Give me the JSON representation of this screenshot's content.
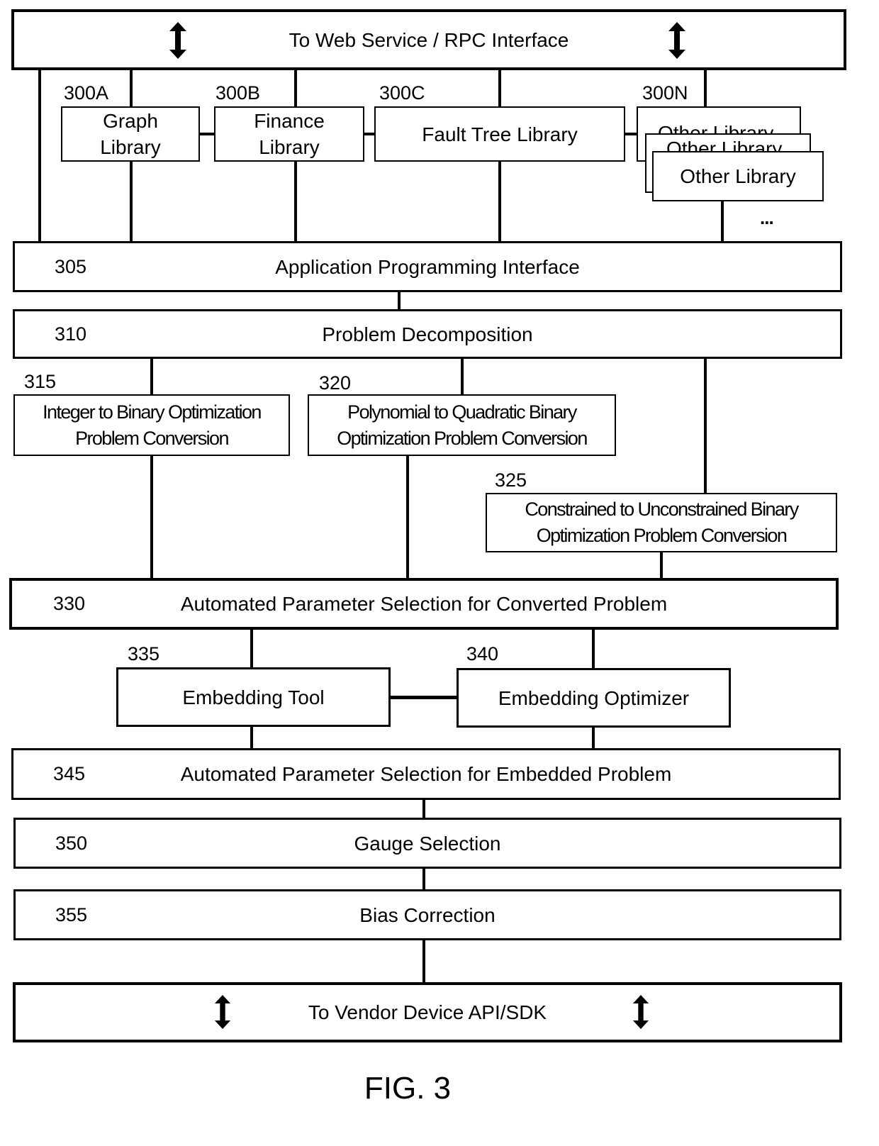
{
  "top_interface": {
    "label": "To Web Service / RPC Interface"
  },
  "libraries": [
    {
      "ref": "300A",
      "label": "Graph\nLibrary"
    },
    {
      "ref": "300B",
      "label": "Finance\nLibrary"
    },
    {
      "ref": "300C",
      "label": "Fault Tree Library"
    },
    {
      "ref": "300N",
      "label": "Other Library",
      "stack_labels": [
        "Other Library",
        "Other Library",
        "Other Library"
      ]
    }
  ],
  "ellipsis": "...",
  "layers": {
    "api": {
      "ref": "305",
      "label": "Application Programming Interface"
    },
    "decomposition": {
      "ref": "310",
      "label": "Problem Decomposition"
    },
    "integer_conv": {
      "ref": "315",
      "label": "Integer to  Binary Optimization\nProblem Conversion"
    },
    "polynomial_conv": {
      "ref": "320",
      "label": "Polynomial to Quadratic  Binary\nOptimization Problem Conversion"
    },
    "constrained_conv": {
      "ref": "325",
      "label": "Constrained to Unconstrained Binary\nOptimization Problem Conversion"
    },
    "param_converted": {
      "ref": "330",
      "label": "Automated Parameter Selection for Converted Problem"
    },
    "embedding_tool": {
      "ref": "335",
      "label": "Embedding Tool"
    },
    "embedding_optimizer": {
      "ref": "340",
      "label": "Embedding Optimizer"
    },
    "param_embedded": {
      "ref": "345",
      "label": "Automated Parameter Selection for Embedded Problem"
    },
    "gauge": {
      "ref": "350",
      "label": "Gauge Selection"
    },
    "bias": {
      "ref": "355",
      "label": "Bias Correction"
    }
  },
  "bottom_interface": {
    "label": "To Vendor Device API/SDK"
  },
  "figure_caption": "FIG. 3",
  "icons": {
    "bidirectional_arrow": "double-headed vertical arrow"
  }
}
